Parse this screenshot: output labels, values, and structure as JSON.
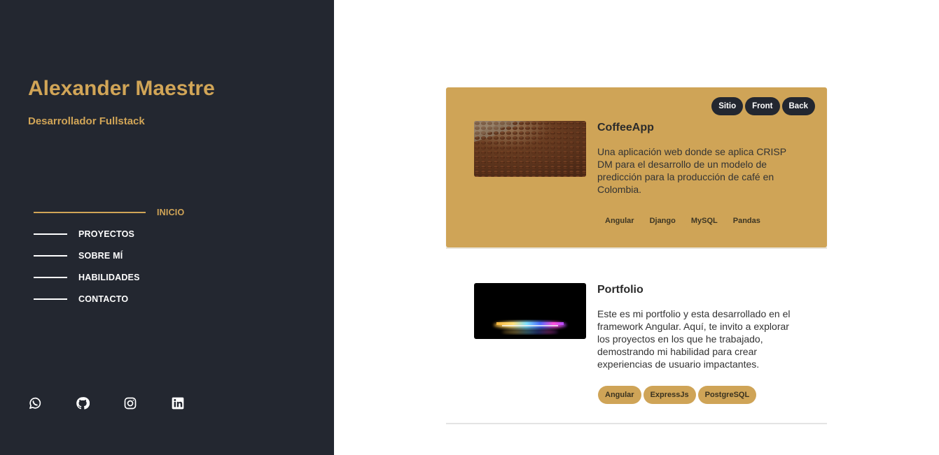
{
  "profile": {
    "name": "Alexander Maestre",
    "role": "Desarrollador Fullstack"
  },
  "nav": {
    "items": [
      {
        "label": "INICIO",
        "active": true
      },
      {
        "label": "PROYECTOS",
        "active": false
      },
      {
        "label": "SOBRE MÍ",
        "active": false
      },
      {
        "label": "HABILIDADES",
        "active": false
      },
      {
        "label": "CONTACTO",
        "active": false
      }
    ]
  },
  "socials": {
    "icons": [
      "whatsapp-icon",
      "github-icon",
      "instagram-icon",
      "linkedin-icon"
    ]
  },
  "colors": {
    "sidebar_bg": "#232730",
    "accent": "#d1a557",
    "card_highlight": "#cfa457"
  },
  "projects": [
    {
      "title": "CoffeeApp",
      "description": "Una aplicación web donde se aplica CRISP DM para el desarrollo de un modelo de predicción para la producción de café en Colombia.",
      "links": [
        "Sitio",
        "Front",
        "Back"
      ],
      "tags": [
        "Angular",
        "Django",
        "MySQL",
        "Pandas"
      ]
    },
    {
      "title": "Portfolio",
      "description": "Este es mi portfolio y esta desarrollado en el framework Angular. Aquí, te invito a explorar los proyectos en los que he trabajado, demostrando mi habilidad para crear experiencias de usuario impactantes.",
      "tags": [
        "Angular",
        "ExpressJs",
        "PostgreSQL"
      ]
    }
  ]
}
